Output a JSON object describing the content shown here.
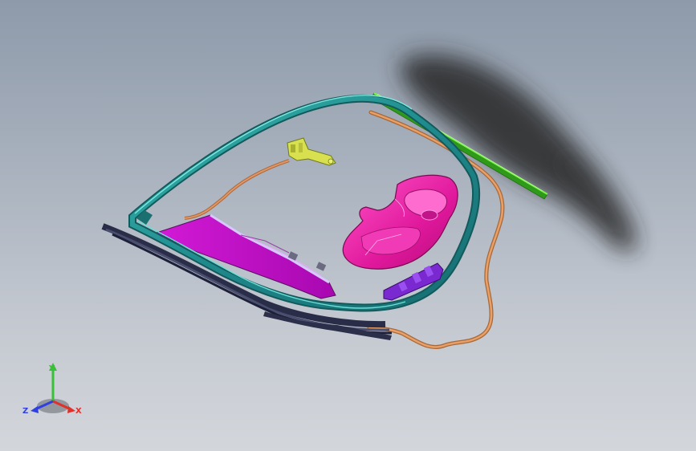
{
  "triad": {
    "x_label": "X",
    "y_label": "Y",
    "z_label": "Z",
    "colors": {
      "x": "#e0302a",
      "y": "#38c038",
      "z": "#2f3fe0"
    }
  },
  "colors": {
    "background_top": "#8e9aaa",
    "background_bottom": "#d3d6db",
    "frame_rail": "#2d9a9a",
    "magenta_part": "#e0189c",
    "purple_panel": "#c000c8",
    "orange_wire": "#d88848",
    "green_bar": "#40d020",
    "violet_bracket": "#7a28d0",
    "yellow_bracket": "#d8e050",
    "shadow": "#2b2b2b"
  }
}
